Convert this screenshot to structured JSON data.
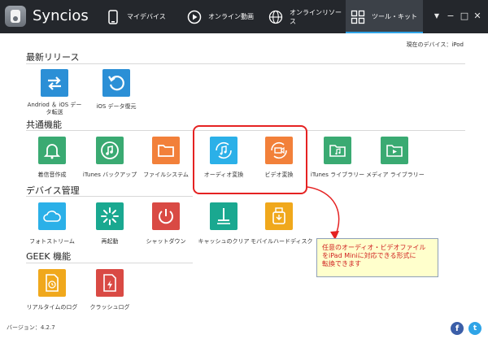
{
  "app": {
    "name": "Syncios",
    "version_label": "バージョン：4.2.7"
  },
  "nav": [
    {
      "label": "マイデバイス",
      "icon": "phone-icon"
    },
    {
      "label": "オンライン動画",
      "icon": "play-icon"
    },
    {
      "label": "オンラインリソース",
      "icon": "globe-icon"
    },
    {
      "label": "ツール・キット",
      "icon": "grid-icon",
      "active": true
    }
  ],
  "window_controls": {
    "menu": "▼",
    "minimize": "−",
    "maximize": "□",
    "close": "✕"
  },
  "device_label": "現在のデバイス：iPod",
  "sections": {
    "latest": "最新リリース",
    "common": "共通機能",
    "device": "デバイス管理",
    "geek": "GEEK 機能"
  },
  "tools": {
    "android_ios_label_1": "Andriod ＆ iOS デー",
    "android_ios_label_2": "タ転送",
    "ios_restore": "iOS データ復元",
    "ringtone": "着信音作成",
    "itunes_backup": "iTunes バックアップ",
    "file_system": "ファイルシステム",
    "audio_convert": "オーディオ変換",
    "video_convert": "ビデオ変換",
    "itunes_library": "iTunes ライブラリー",
    "media_library": "メディア ライブラリー",
    "photo_stream": "フォトストリーム",
    "restart": "再起動",
    "shutdown": "シャットダウン",
    "clear_cache": "キャッシュのクリア",
    "mobile_hd": "モバイルハードディスク",
    "realtime_log": "リアルタイムのログ",
    "crash_log": "クラッシュログ"
  },
  "callout": {
    "line1": "任意のオーディオ・ビデオファイル",
    "line2": "をiPad Miniに対応できる形式に",
    "line3": "転換できます"
  },
  "colors": {
    "topbar": "#24272c",
    "blue": "#2b8fd6",
    "green": "#3aaa72",
    "orange": "#f2803a",
    "red": "#d94a44",
    "teal": "#1aa890",
    "yellow": "#f0a81c",
    "highlight": "#e52222"
  }
}
